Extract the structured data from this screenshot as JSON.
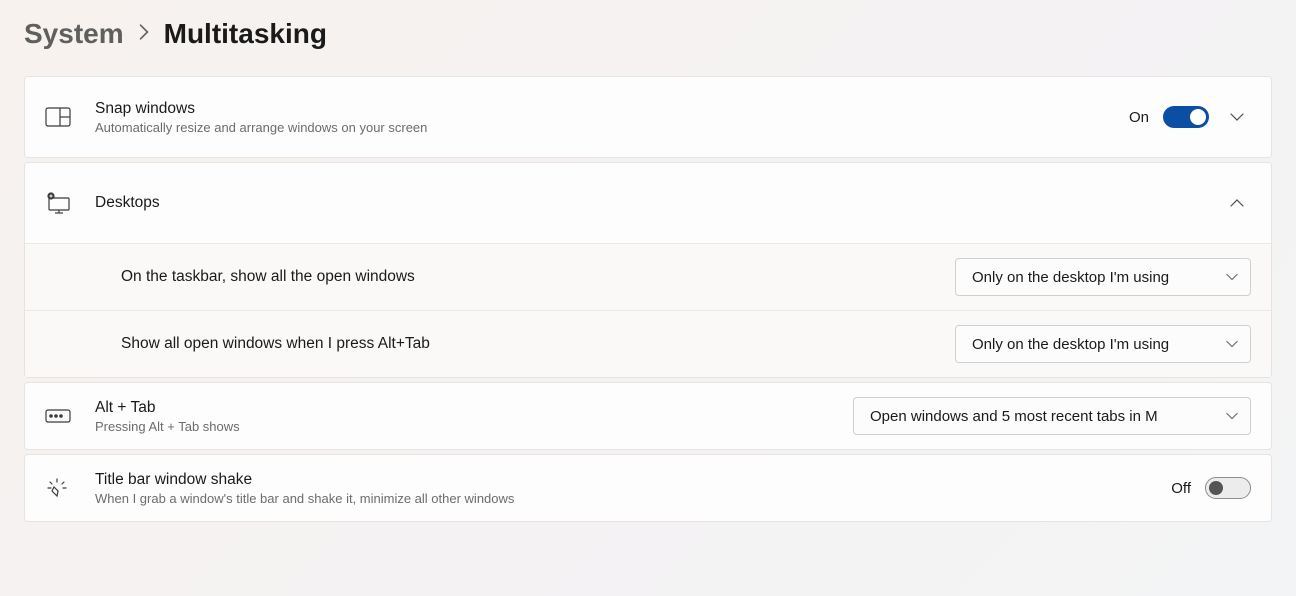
{
  "breadcrumb": {
    "parent": "System",
    "current": "Multitasking"
  },
  "sections": {
    "snap": {
      "title": "Snap windows",
      "desc": "Automatically resize and arrange windows on your screen",
      "toggle_label": "On",
      "toggle_state": "on"
    },
    "desktops": {
      "title": "Desktops",
      "sub_taskbar": {
        "label": "On the taskbar, show all the open windows",
        "value": "Only on the desktop I'm using"
      },
      "sub_alttab": {
        "label": "Show all open windows when I press Alt+Tab",
        "value": "Only on the desktop I'm using"
      }
    },
    "alttab": {
      "title": "Alt + Tab",
      "desc": "Pressing Alt + Tab shows",
      "value": "Open windows and 5 most recent tabs in M"
    },
    "shake": {
      "title": "Title bar window shake",
      "desc": "When I grab a window's title bar and shake it, minimize all other windows",
      "toggle_label": "Off",
      "toggle_state": "off"
    }
  }
}
